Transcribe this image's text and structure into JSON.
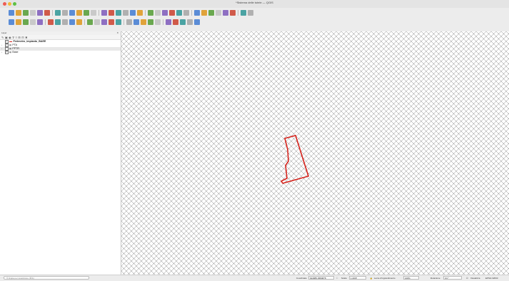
{
  "window": {
    "title": "*Sistema delle tutele — QGIS"
  },
  "colors": {
    "feature_outline": "#d6231c",
    "hatch": "#7a7a7a"
  },
  "toolbar_icons": {
    "row1": [
      "new-project",
      "open-project",
      "save-project",
      "save-as",
      "print-layout",
      "layout-manager",
      "pan",
      "pan-to-selection",
      "zoom-in",
      "zoom-out",
      "zoom-full",
      "zoom-to-selection",
      "zoom-to-layer",
      "zoom-native",
      "zoom-last",
      "zoom-next",
      "refresh",
      "new-map-view",
      "new-3d-map-view",
      "new-bookmark",
      "show-bookmarks",
      "temporal-controller",
      "identify",
      "select-features",
      "deselect",
      "attribute-table",
      "statistics",
      "open-field-calculator",
      "measure",
      "annotation",
      "python-console",
      "help"
    ],
    "row2": [
      "data-source-manager",
      "new-geopackage",
      "new-shapefile",
      "new-spatialite",
      "new-virtual-layer",
      "toggle-editing",
      "save-edits",
      "digitize",
      "add-polygon",
      "vertex-tool",
      "delete-selected",
      "cut",
      "copy",
      "paste",
      "undo",
      "redo",
      "label-tool",
      "diagram",
      "pin-labels",
      "show-hide-labels",
      "move-label",
      "rotate-label",
      "change-label",
      "plugin-1",
      "plugin-2"
    ]
  },
  "layers_panel": {
    "title": "Layer",
    "toolbar": [
      "open-styling",
      "add-group",
      "manage-visibility",
      "filter",
      "filter-legend",
      "expand-all",
      "collapse-all",
      "remove-layer"
    ],
    "items": [
      {
        "name": "Perimetro_impianto_BAEE",
        "checked": true,
        "type": "line"
      },
      {
        "name": "PTA",
        "checked": true,
        "type": "group"
      },
      {
        "name": "PPTR",
        "checked": false,
        "type": "group",
        "selected": true
      },
      {
        "name": "Base",
        "checked": true,
        "type": "group"
      }
    ]
  },
  "statusbar": {
    "locator_placeholder": "Digita per localizzare (⌘K)",
    "coordinate_label": "Coordinate",
    "coordinate_value": "624985,4584878",
    "scale_label": "Scala",
    "scale_value": "1:4097",
    "magnifier_label": "Lente d'ingrandimento",
    "magnifier_value": "100%",
    "rotation_label": "Rotazione",
    "rotation_value": "0,0 °",
    "render_label": "Visualizza",
    "crs": "EPSG:32633"
  }
}
